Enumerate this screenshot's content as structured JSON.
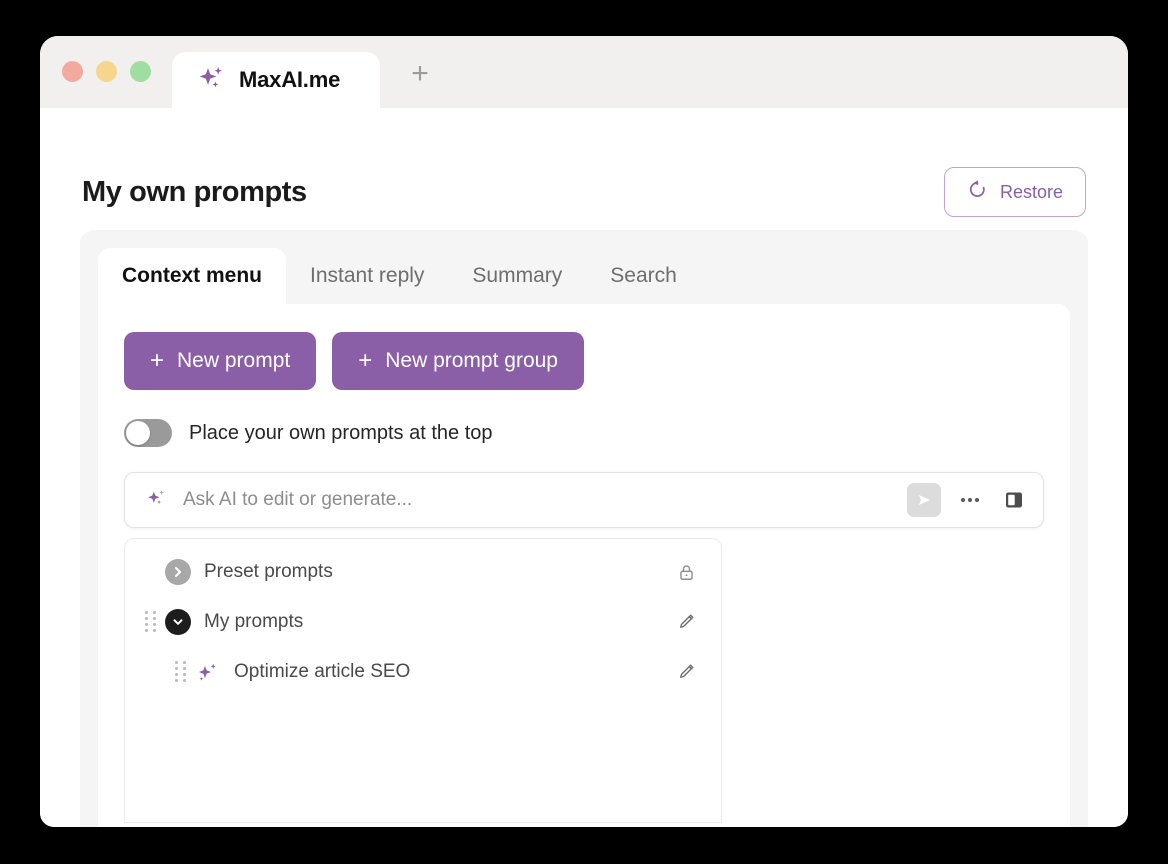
{
  "browser": {
    "traffic_lights": [
      "close",
      "minimize",
      "maximize"
    ],
    "tab": {
      "title": "MaxAI.me",
      "icon": "sparkle-icon"
    },
    "new_tab_label": "+"
  },
  "page": {
    "title": "My own prompts",
    "restore_button": {
      "label": "Restore",
      "icon": "restore-circular-arrow-icon"
    }
  },
  "tabs": [
    {
      "label": "Context menu",
      "active": true
    },
    {
      "label": "Instant reply",
      "active": false
    },
    {
      "label": "Summary",
      "active": false
    },
    {
      "label": "Search",
      "active": false
    }
  ],
  "actions": {
    "new_prompt_label": "New prompt",
    "new_prompt_group_label": "New prompt group",
    "plus_glyph": "+"
  },
  "toggle": {
    "label": "Place your own prompts at the top",
    "enabled": false
  },
  "ai_bar": {
    "placeholder": "Ask AI to edit or generate...",
    "value": "",
    "send_icon": "send-triangle-icon",
    "more_icon": "more-dots-icon",
    "panel_icon": "side-panel-icon"
  },
  "prompt_list": [
    {
      "label": "Preset prompts",
      "type": "group",
      "expanded": false,
      "draggable": false,
      "right_icon": "lock-icon",
      "chevron": "chevron-right-icon",
      "chevron_style": "gray"
    },
    {
      "label": "My prompts",
      "type": "group",
      "expanded": true,
      "draggable": true,
      "right_icon": "pencil-icon",
      "chevron": "chevron-down-icon",
      "chevron_style": "dark"
    },
    {
      "label": "Optimize article SEO",
      "type": "prompt",
      "expanded": false,
      "draggable": true,
      "right_icon": "pencil-icon",
      "chevron": "sparkle-icon",
      "chevron_style": "sparkle"
    }
  ],
  "colors": {
    "accent_purple": "#8b5ea8",
    "accent_purple_border": "#c0a4d4",
    "card_bg": "#f5f5f5",
    "tabstrip_bg": "#f1f0ee",
    "desktop_bg": "#000000",
    "traffic_red": "#f4a9a0",
    "traffic_yellow": "#f5d68c",
    "traffic_green": "#9fdda0"
  }
}
